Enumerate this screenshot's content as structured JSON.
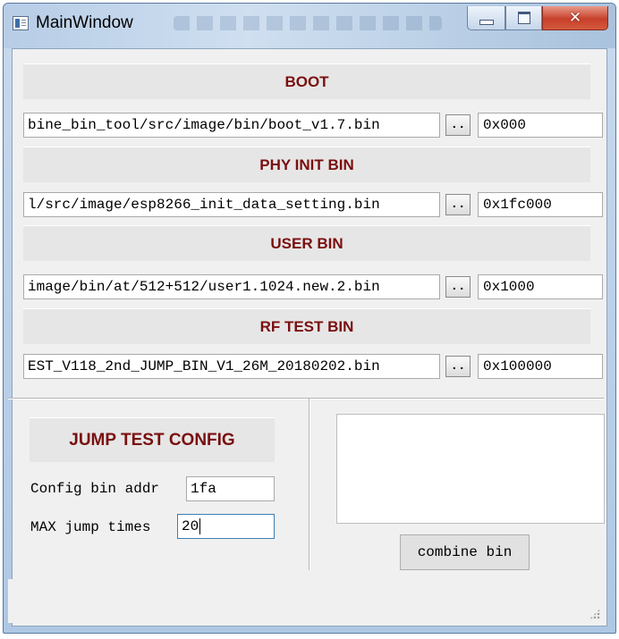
{
  "window": {
    "title": "MainWindow",
    "close_glyph": "✕"
  },
  "sections": [
    {
      "header": "BOOT",
      "path": "bine_bin_tool/src/image/bin/boot_v1.7.bin",
      "browse_label": "..",
      "address": "0x000"
    },
    {
      "header": "PHY INIT BIN",
      "path": "l/src/image/esp8266_init_data_setting.bin",
      "browse_label": "..",
      "address": "0x1fc000"
    },
    {
      "header": "USER BIN",
      "path": "image/bin/at/512+512/user1.1024.new.2.bin",
      "browse_label": "..",
      "address": "0x1000"
    },
    {
      "header": "RF TEST BIN",
      "path": "EST_V118_2nd_JUMP_BIN_V1_26M_20180202.bin",
      "browse_label": "..",
      "address": "0x100000"
    }
  ],
  "jump_config": {
    "header": "JUMP TEST CONFIG",
    "config_addr_label": "Config bin addr",
    "config_addr_value": "1fa",
    "max_jump_label": "MAX jump times",
    "max_jump_value": "20"
  },
  "log": {
    "text": ""
  },
  "actions": {
    "combine_label": "combine bin"
  },
  "colors": {
    "header_text": "#7a0f0f",
    "panel_bg": "#f0f0f0",
    "header_bg": "#e6e6e6",
    "close_button": "#c8402a"
  },
  "icons": [
    "app-icon",
    "minimize-icon",
    "maximize-icon",
    "close-icon",
    "resize-grip-icon"
  ]
}
